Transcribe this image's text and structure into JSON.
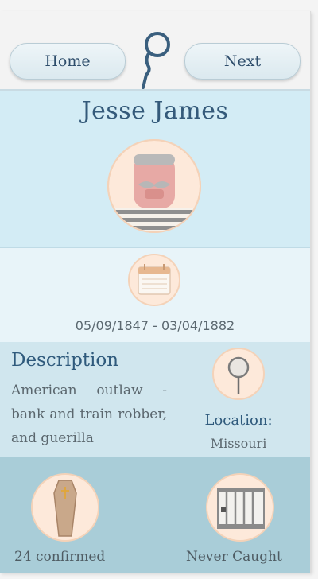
{
  "header": {
    "home_label": "Home",
    "next_label": "Next"
  },
  "profile": {
    "name": "Jesse James",
    "dates": "05/09/1847 - 03/04/1882"
  },
  "description": {
    "title": "Description",
    "text": "American outlaw - bank and train robber, and guerilla"
  },
  "location": {
    "label": "Location:",
    "value": "Missouri"
  },
  "stats": {
    "kills": "24 confirmed",
    "status": "Never Caught"
  },
  "icons": {
    "logo": "magnifier-icon",
    "avatar": "outlaw-avatar-icon",
    "calendar": "calendar-icon",
    "location": "location-pin-icon",
    "coffin": "coffin-icon",
    "jail": "jail-cell-icon"
  },
  "colors": {
    "heading": "#345a7a",
    "name_bg": "#d3ecf5",
    "desc_bg": "#d0e6ee",
    "bottom_bg": "#a9cdd8",
    "icon_circle": "#fde9da"
  }
}
